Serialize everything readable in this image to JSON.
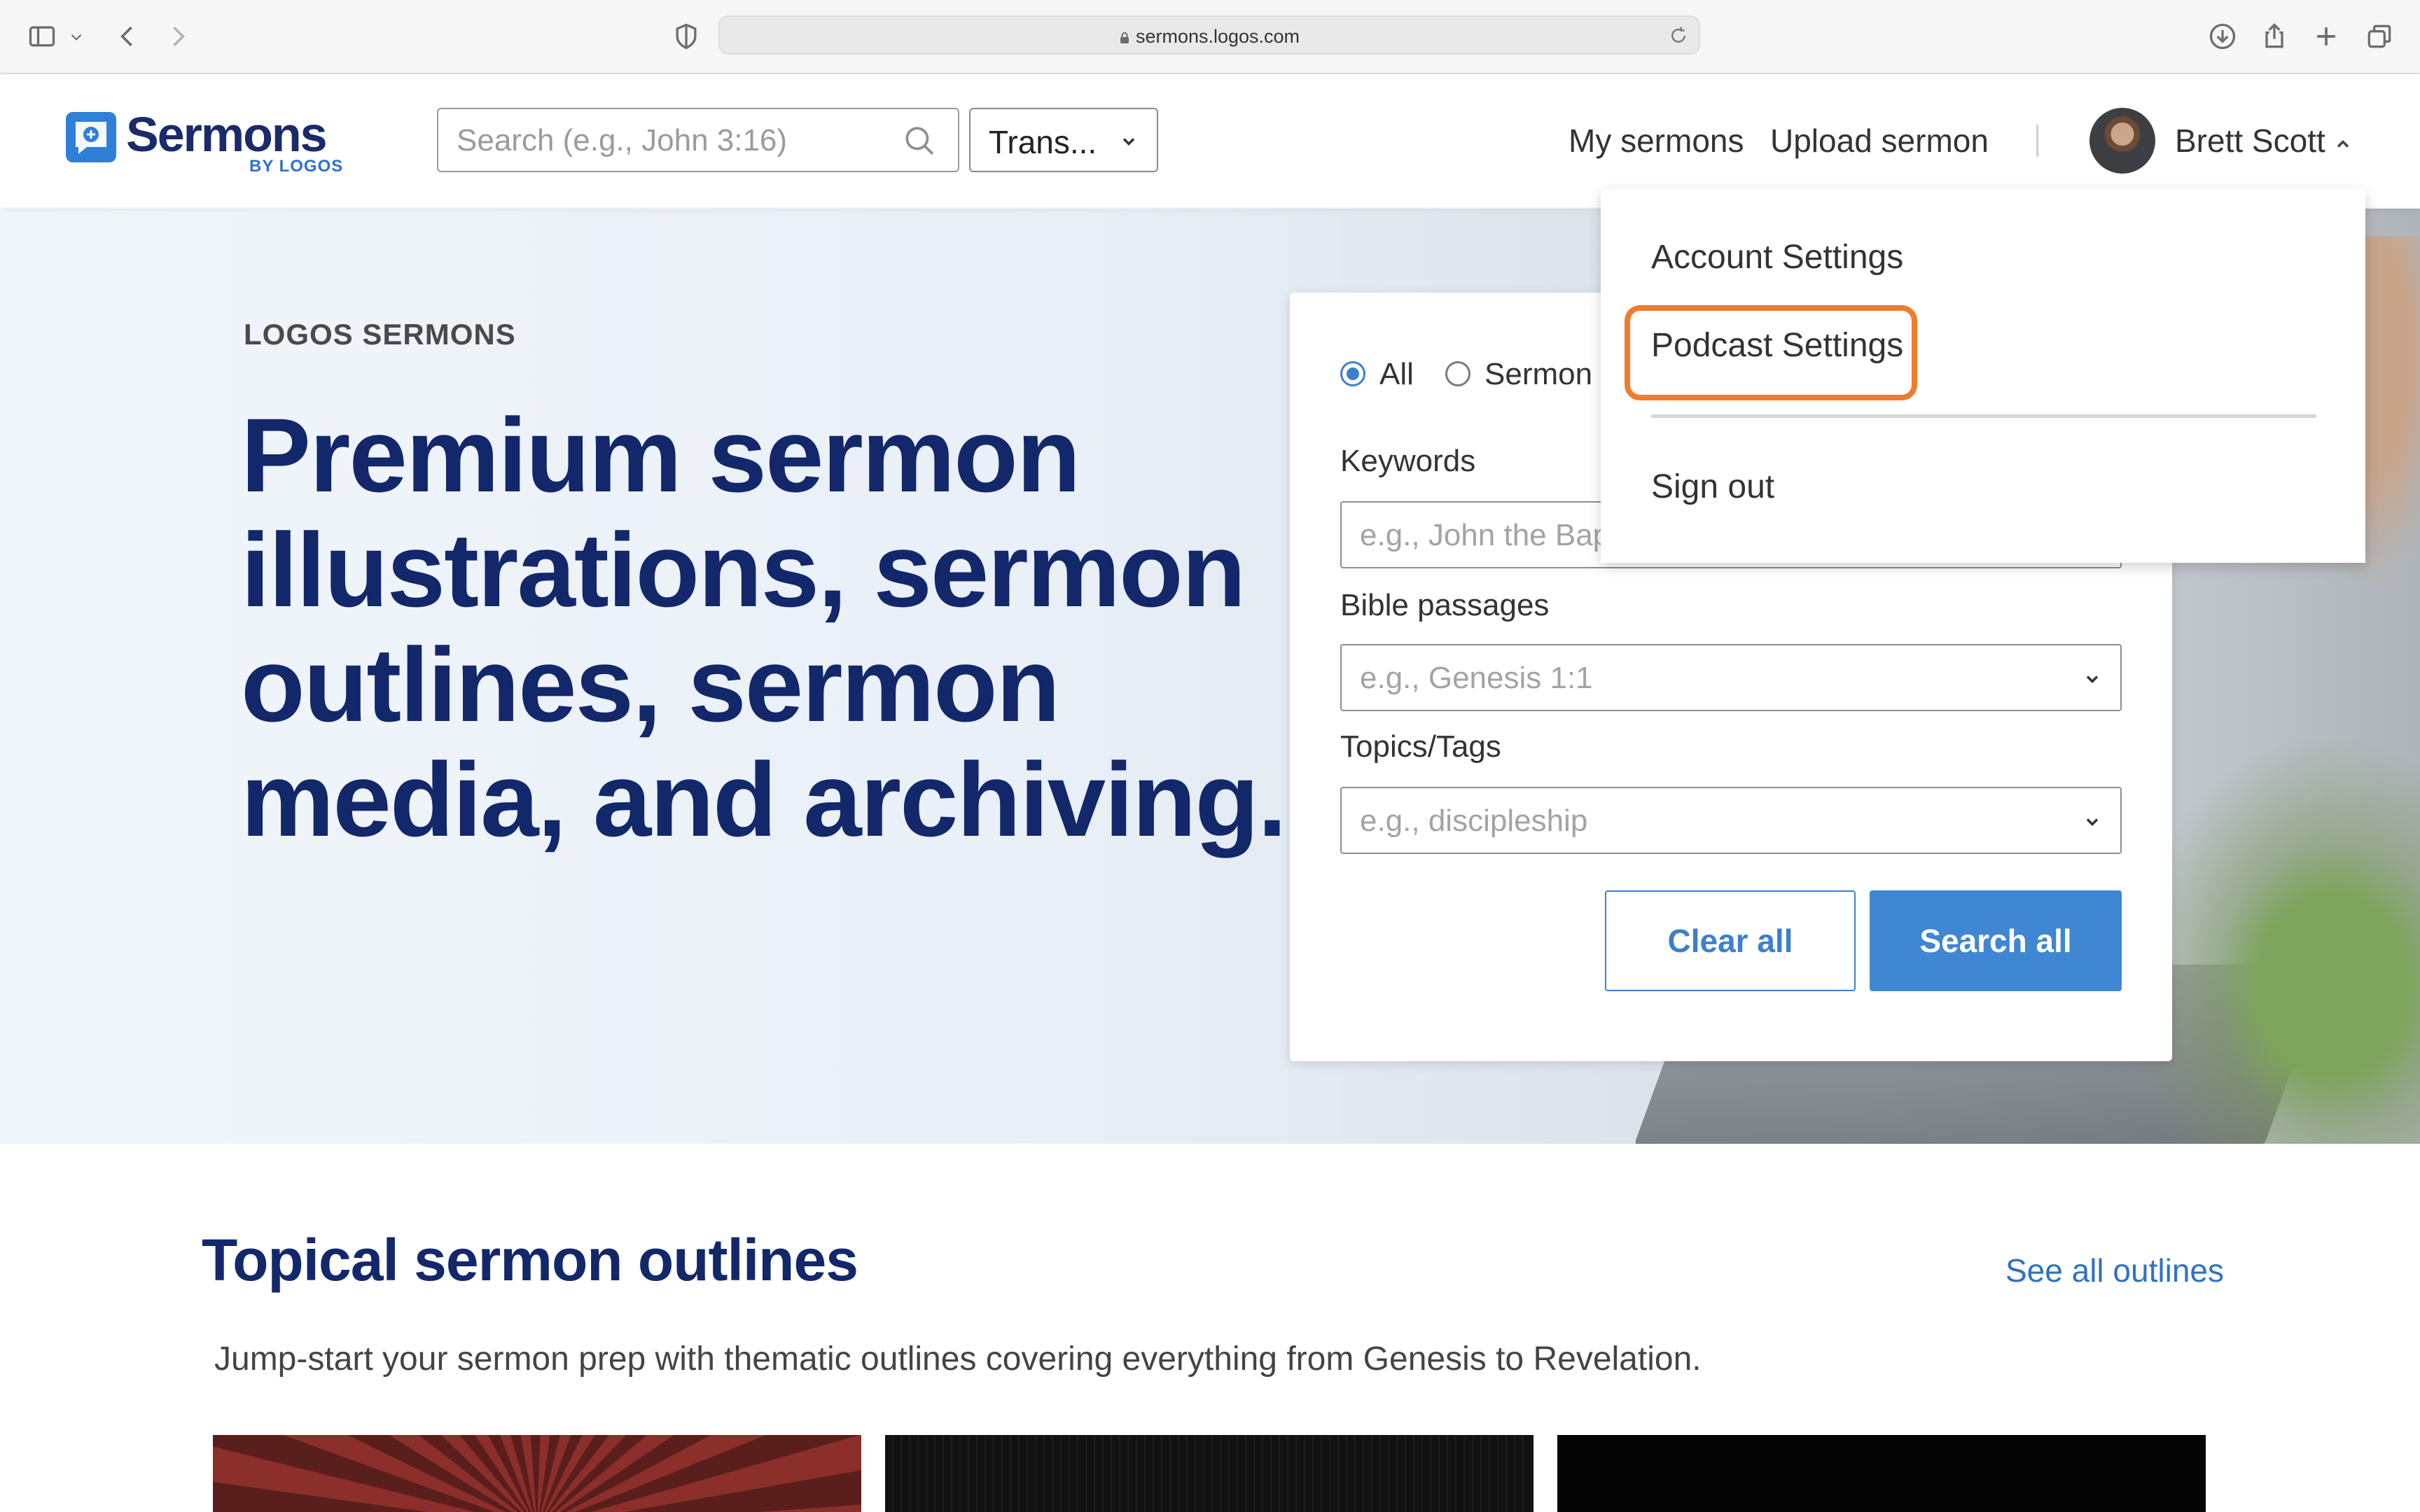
{
  "browser": {
    "url": "sermons.logos.com"
  },
  "header": {
    "logo_text": "Sermons",
    "logo_sub": "BY LOGOS",
    "search_placeholder": "Search (e.g., John 3:16)",
    "translation_label": "Trans...",
    "nav": {
      "my_sermons": "My sermons",
      "upload_sermon": "Upload sermon"
    },
    "user_name": "Brett Scott"
  },
  "dropdown": {
    "account_settings": "Account Settings",
    "podcast_settings": "Podcast Settings",
    "sign_out": "Sign out",
    "highlight_color": "#f07a2d"
  },
  "hero": {
    "eyebrow": "LOGOS SERMONS",
    "title": "Premium sermon illustrations, sermon outlines, sermon media, and archiving."
  },
  "search_card": {
    "radios": [
      {
        "label": "All",
        "selected": true
      },
      {
        "label": "Sermon",
        "selected": false
      }
    ],
    "keywords_label": "Keywords",
    "keywords_placeholder": "e.g., John the Bap",
    "passages_label": "Bible passages",
    "passages_placeholder": "e.g., Genesis 1:1",
    "topics_label": "Topics/Tags",
    "topics_placeholder": "e.g., discipleship",
    "clear_label": "Clear all",
    "search_label": "Search all"
  },
  "outlines": {
    "title": "Topical sermon outlines",
    "see_all": "See all outlines",
    "description": "Jump-start your sermon prep with thematic outlines covering everything from Genesis to Revelation."
  },
  "colors": {
    "brand_navy": "#13286a",
    "accent_blue": "#3f86d3"
  }
}
